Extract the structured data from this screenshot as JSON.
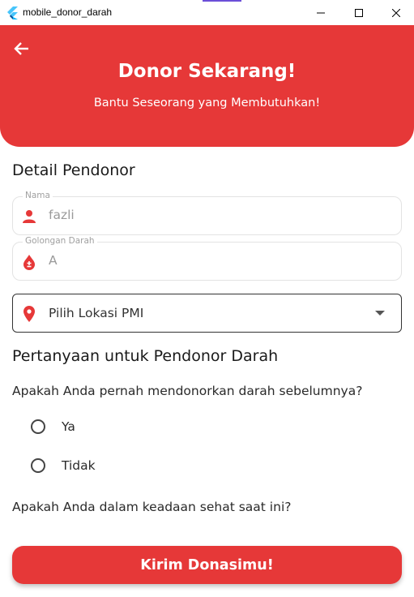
{
  "window": {
    "title": "mobile_donor_darah",
    "app_icon": "flutter-icon",
    "controls": [
      "minimize-icon",
      "maximize-icon",
      "close-icon"
    ]
  },
  "header": {
    "back_icon": "arrow-left-icon",
    "title": "Donor Sekarang!",
    "subtitle": "Bantu Seseorang yang Membutuhkan!",
    "color": "#e63838"
  },
  "donor_details": {
    "section_title": "Detail Pendonor",
    "name_field": {
      "label": "Nama",
      "value": "fazli",
      "icon": "person-icon"
    },
    "blood_type_field": {
      "label": "Golongan Darah",
      "value": "A",
      "icon": "blood-drop-icon"
    },
    "location_dropdown": {
      "value": "Pilih Lokasi PMI",
      "icon": "location-pin-icon"
    }
  },
  "questions": {
    "section_title": "Pertanyaan untuk Pendonor Darah",
    "q1": {
      "text": "Apakah Anda pernah mendonorkan darah sebelumnya?",
      "options": [
        "Ya",
        "Tidak"
      ]
    },
    "q2": {
      "text": "Apakah Anda dalam keadaan sehat saat ini?"
    }
  },
  "submit_label": "Kirim Donasimu!"
}
